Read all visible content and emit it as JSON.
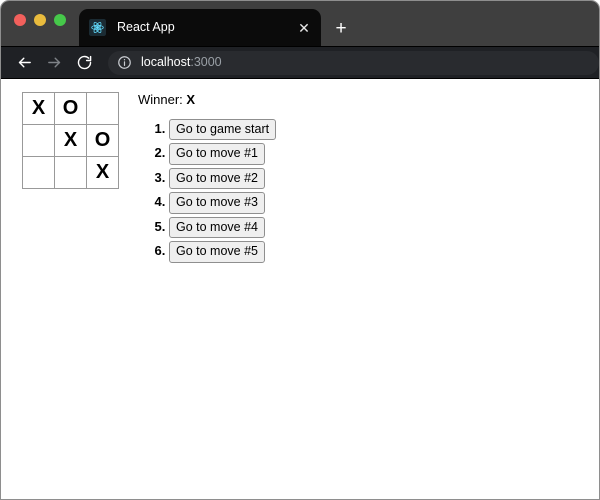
{
  "window": {
    "traffic_lights": [
      {
        "name": "close",
        "color": "#f2605c"
      },
      {
        "name": "minimize",
        "color": "#e9bb3d"
      },
      {
        "name": "maximize",
        "color": "#46c84a"
      }
    ]
  },
  "tabstrip": {
    "tabs": [
      {
        "title": "React App",
        "favicon": "react-logo-icon",
        "close_label": "✕",
        "active": true
      }
    ],
    "new_tab_label": "+"
  },
  "navbar": {
    "back_label": "back-arrow-icon",
    "forward_label": "forward-arrow-icon",
    "reload_label": "reload-icon",
    "omnibox": {
      "info_icon": "info-circle-icon",
      "host": "localhost",
      "port": ":3000",
      "full_url": "localhost:3000"
    }
  },
  "page": {
    "board": {
      "rows": [
        [
          "X",
          "O",
          ""
        ],
        [
          "",
          "X",
          "O"
        ],
        [
          "",
          "",
          "X"
        ]
      ]
    },
    "status": {
      "prefix": "Winner: ",
      "winner": "X",
      "text": "Winner: X"
    },
    "moves": [
      {
        "label": "Go to game start"
      },
      {
        "label": "Go to move #1"
      },
      {
        "label": "Go to move #2"
      },
      {
        "label": "Go to move #3"
      },
      {
        "label": "Go to move #4"
      },
      {
        "label": "Go to move #5"
      }
    ]
  },
  "colors": {
    "tabstrip_bg": "#3f3f3f",
    "navbar_bg": "#1f2125",
    "active_tab_bg": "#0b0b0b",
    "omnibox_bg": "#292b2f",
    "react_cyan": "#61dafb",
    "board_border": "#999999",
    "button_bg": "#efefef",
    "button_border": "#8f8f8f",
    "page_bg": "#ffffff"
  }
}
